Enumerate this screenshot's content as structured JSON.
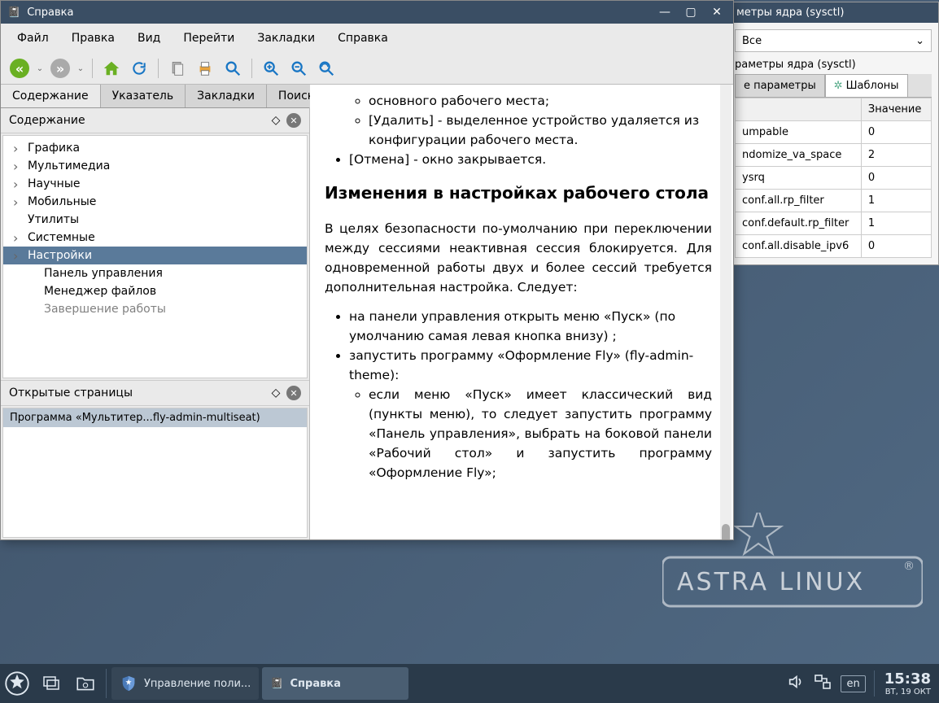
{
  "desktop": {
    "brand": "ASTRA LINUX"
  },
  "taskbar": {
    "items": [
      {
        "label": "Управление поли...",
        "icon": "shield"
      },
      {
        "label": "Справка",
        "icon": "book"
      }
    ],
    "lang": "en",
    "time": "15:38",
    "date": "ВТ, 19 ОКТ"
  },
  "bg_window": {
    "title": "метры ядра (sysctl)",
    "dropdown": "Все",
    "subtitle": "раметры ядра (sysctl)",
    "tabs": [
      "е параметры",
      "Шаблоны"
    ],
    "columns": [
      "",
      "Значение"
    ],
    "rows": [
      [
        "umpable",
        "0"
      ],
      [
        "ndomize_va_space",
        "2"
      ],
      [
        "ysrq",
        "0"
      ],
      [
        "conf.all.rp_filter",
        "1"
      ],
      [
        "conf.default.rp_filter",
        "1"
      ],
      [
        "conf.all.disable_ipv6",
        "0"
      ]
    ]
  },
  "help_window": {
    "title": "Справка",
    "menu": [
      "Файл",
      "Правка",
      "Вид",
      "Перейти",
      "Закладки",
      "Справка"
    ],
    "left_tabs": [
      "Содержание",
      "Указатель",
      "Закладки",
      "Поиск"
    ],
    "pane_contents_title": "Содержание",
    "tree": [
      {
        "label": "Графика",
        "children": true
      },
      {
        "label": "Мультимедиа",
        "children": true
      },
      {
        "label": "Научные",
        "children": true
      },
      {
        "label": "Мобильные",
        "children": true
      },
      {
        "label": "Утилиты"
      },
      {
        "label": "Системные",
        "children": true
      },
      {
        "label": "Настройки",
        "children": true,
        "selected": true
      },
      {
        "label": "Панель управления"
      },
      {
        "label": "Менеджер файлов"
      },
      {
        "label": "Завершение работы"
      }
    ],
    "open_pages_title": "Открытые страницы",
    "open_pages": [
      "Программа «Мультитер...fly-admin-multiseat)"
    ],
    "content": {
      "intro_list": [
        "основного рабочего места;",
        "[Удалить] - выделенное устройство удаляется из конфигурации рабочего места."
      ],
      "intro_last": "[Отмена] - окно закрывается.",
      "heading": "Изменения в настройках рабочего стола",
      "paragraph": "В целях безопасности по-умолчанию при переключении между сессиями неактивная сессия блокируется. Для одновременной работы двух и более сессий требуется дополнительная настройка. Следует:",
      "steps": [
        "на панели управления открыть меню «Пуск» (по умолчанию самая левая кнопка внизу) ;",
        "запустить программу «Оформление Fly» (fly-admin-theme):"
      ],
      "substep": "если меню «Пуск» имеет классический вид (пункты меню), то следует запустить программу «Панель управления», выбрать на боковой панели «Рабочий стол» и запустить программу «Оформление Fly»;"
    }
  }
}
